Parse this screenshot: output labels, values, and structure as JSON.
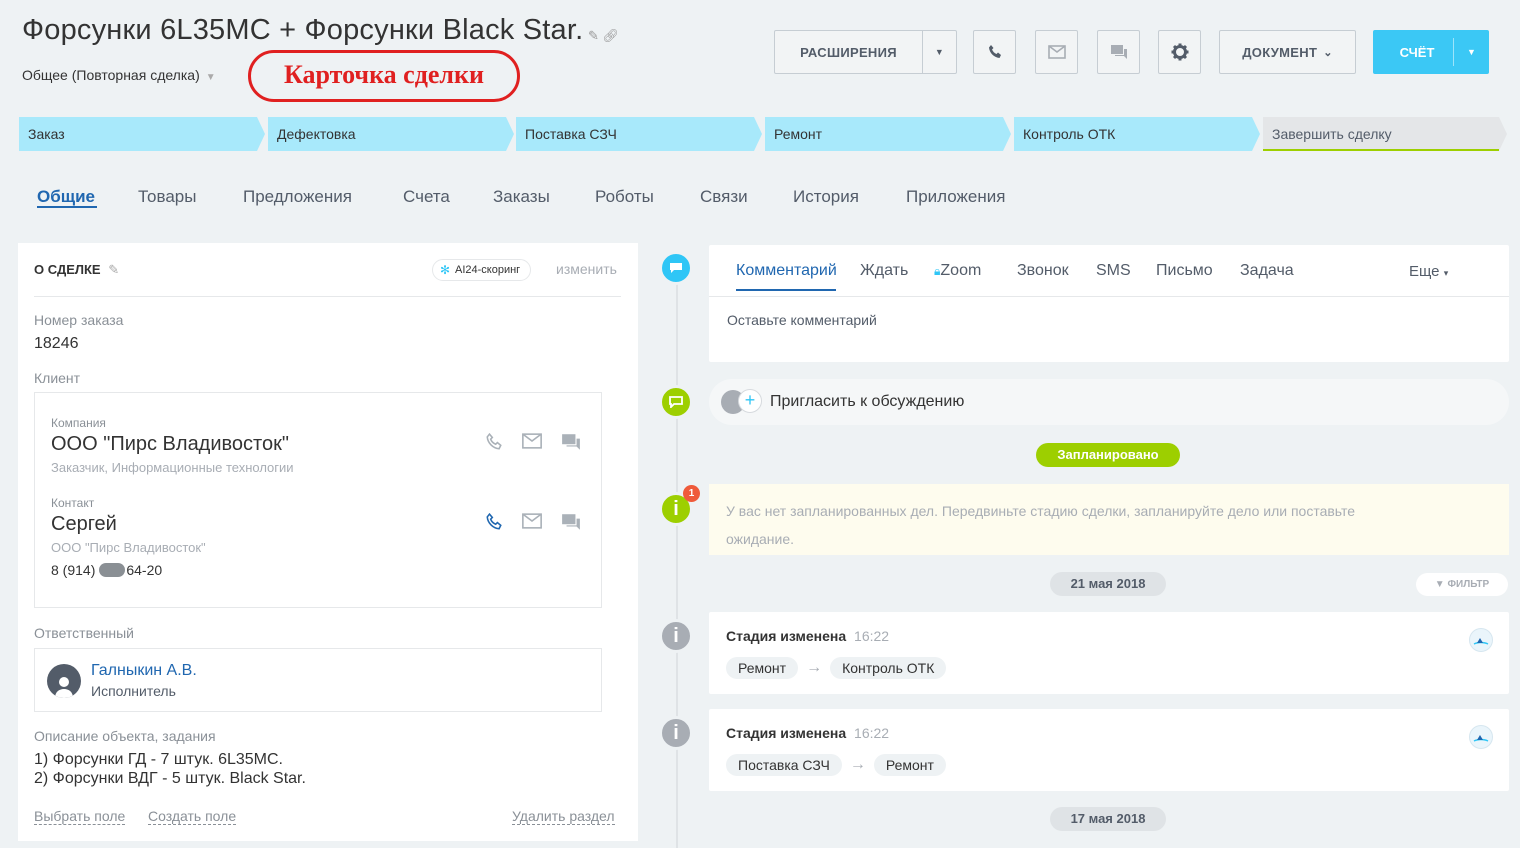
{
  "header": {
    "title": "Форсунки 6L35MC + Форсунки Black  Star.",
    "category": "Общее (Повторная сделка)",
    "annotation": "Карточка сделки",
    "buttons": {
      "extensions": "РАСШИРЕНИЯ",
      "document": "ДОКУМЕНТ",
      "invoice": "СЧЁТ"
    }
  },
  "stages": [
    {
      "label": "Заказ",
      "color": "#a8e9fb"
    },
    {
      "label": "Дефектовка",
      "color": "#a8e9fb"
    },
    {
      "label": "Поставка СЗЧ",
      "color": "#a8e9fb"
    },
    {
      "label": "Ремонт",
      "color": "#a8e9fb"
    },
    {
      "label": "Контроль ОТК",
      "color": "#a8e9fb"
    },
    {
      "label": "Завершить сделку",
      "color": "#e4e6e8"
    }
  ],
  "tabs": [
    "Общие",
    "Товары",
    "Предложения",
    "Счета",
    "Заказы",
    "Роботы",
    "Связи",
    "История",
    "Приложения"
  ],
  "about": {
    "section_title": "О СДЕЛКЕ",
    "scoring": "AI24-скоринг",
    "change": "изменить",
    "order_number_label": "Номер заказа",
    "order_number": "18246",
    "client_label": "Клиент",
    "company_label": "Компания",
    "company_name": "ООО \"Пирс Владивосток\"",
    "company_type": "Заказчик, Информационные технологии",
    "contact_label": "Контакт",
    "contact_name": "Сергей",
    "contact_company": "ООО \"Пирс Владивосток\"",
    "contact_phone_start": "8 (914)",
    "contact_phone_end": "64-20",
    "responsible_label": "Ответственный",
    "responsible_name": "Галныкин А.В.",
    "responsible_role": "Исполнитель",
    "description_label": "Описание объекта, задания",
    "description_line1": "1) Форсунки ГД - 7 штук. 6L35MC.",
    "description_line2": "2) Форсунки ВДГ - 5 штук. Black Star.",
    "select_field": "Выбрать поле",
    "create_field": "Создать поле",
    "delete_section": "Удалить раздел"
  },
  "timeline": {
    "composer_tabs": [
      "Комментарий",
      "Ждать",
      "Zoom",
      "Звонок",
      "SMS",
      "Письмо",
      "Задача"
    ],
    "more": "Еще",
    "comment_placeholder": "Оставьте комментарий",
    "invite": "Пригласить к обсуждению",
    "planned_badge": "Запланировано",
    "notice_count": "1",
    "notice_text_1": "У вас нет запланированных дел. Передвиньте стадию сделки, запланируйте дело или поставьте",
    "notice_text_2": "ожидание.",
    "date1": "21 мая 2018",
    "filter": "ФИЛЬТР",
    "events": [
      {
        "title": "Стадия изменена",
        "time": "16:22",
        "from": "Ремонт",
        "to": "Контроль ОТК"
      },
      {
        "title": "Стадия изменена",
        "time": "16:22",
        "from": "Поставка СЗЧ",
        "to": "Ремонт"
      }
    ],
    "date2": "17 мая 2018"
  },
  "colors": {
    "accent": "#3bc8f5",
    "link": "#2067b0",
    "green": "#9dcf00",
    "annotation": "#e02020"
  }
}
